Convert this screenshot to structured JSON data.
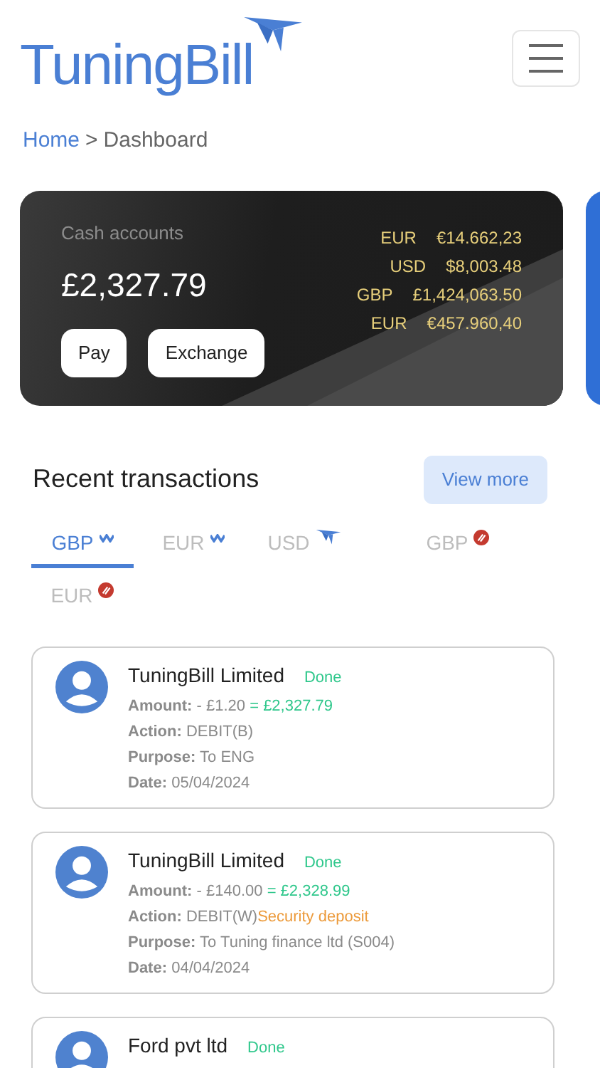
{
  "header": {
    "logo": "TuningBill"
  },
  "breadcrumb": {
    "home": "Home",
    "separator": ">",
    "current": "Dashboard"
  },
  "cash_card": {
    "title": "Cash accounts",
    "balance": "£2,327.79",
    "buttons": [
      "Pay",
      "Exchange"
    ],
    "accounts": [
      {
        "currency": "EUR",
        "amount": "€14.662,23"
      },
      {
        "currency": "USD",
        "amount": "$8,003.48"
      },
      {
        "currency": "GBP",
        "amount": "£1,424,063.50"
      },
      {
        "currency": "EUR",
        "amount": "€457.960,40"
      }
    ]
  },
  "transactions": {
    "title": "Recent transactions",
    "view_more": "View more",
    "tabs": [
      {
        "label": "GBP",
        "kind": "wave",
        "selected": true
      },
      {
        "label": "EUR",
        "kind": "wave",
        "selected": false
      },
      {
        "label": "USD",
        "kind": "plane",
        "selected": false
      },
      {
        "label": "GBP",
        "kind": "blocked",
        "selected": false
      },
      {
        "label": "EUR",
        "kind": "blocked",
        "selected": false
      }
    ],
    "items": [
      {
        "name": "TuningBill Limited",
        "status": "Done",
        "amount_label": "Amount:",
        "amount": "- £1.20",
        "balance": "= £2,327.79",
        "action_label": "Action:",
        "action": "DEBIT(B)",
        "purpose_label": "Purpose:",
        "purpose": "To ENG",
        "date_label": "Date:",
        "date": "05/04/2024"
      },
      {
        "name": "TuningBill Limited",
        "status": "Done",
        "amount_label": "Amount:",
        "amount": "- £140.00",
        "balance": "= £2,328.99",
        "action_label": "Action:",
        "action": "DEBIT(W)",
        "action_note": "Security deposit",
        "purpose_label": "Purpose:",
        "purpose": "To Tuning finance ltd (S004)",
        "date_label": "Date:",
        "date": "04/04/2024"
      },
      {
        "name": "Ford pvt ltd",
        "status": "Done"
      }
    ]
  }
}
